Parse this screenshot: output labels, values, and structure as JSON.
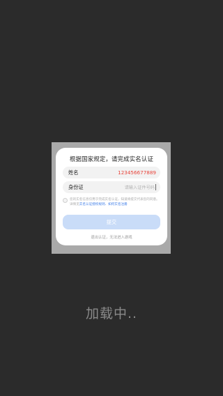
{
  "dialog": {
    "title": "根据国家规定，请完成实名认证",
    "name_label": "姓名",
    "name_value": "123456677889",
    "id_label": "身份证",
    "id_placeholder": "请输入证件号码",
    "agreement": {
      "text_prefix": "您的实名信息仅用于完成实名认证，知道将提交代表您的同意。详情见",
      "link_rules": "实名认证授权规则",
      "separator": "、",
      "link_register": "如何实名注册"
    },
    "submit_label": "提交",
    "exit_label": "退出认证，无法进入游戏"
  },
  "loading_text": "加载中..",
  "colors": {
    "background": "#2b2b2b",
    "overlay": "#a9a9a9",
    "accent_link": "#3f7ee8",
    "name_value": "#e8453c",
    "submit_bg": "#c9dcf8"
  }
}
